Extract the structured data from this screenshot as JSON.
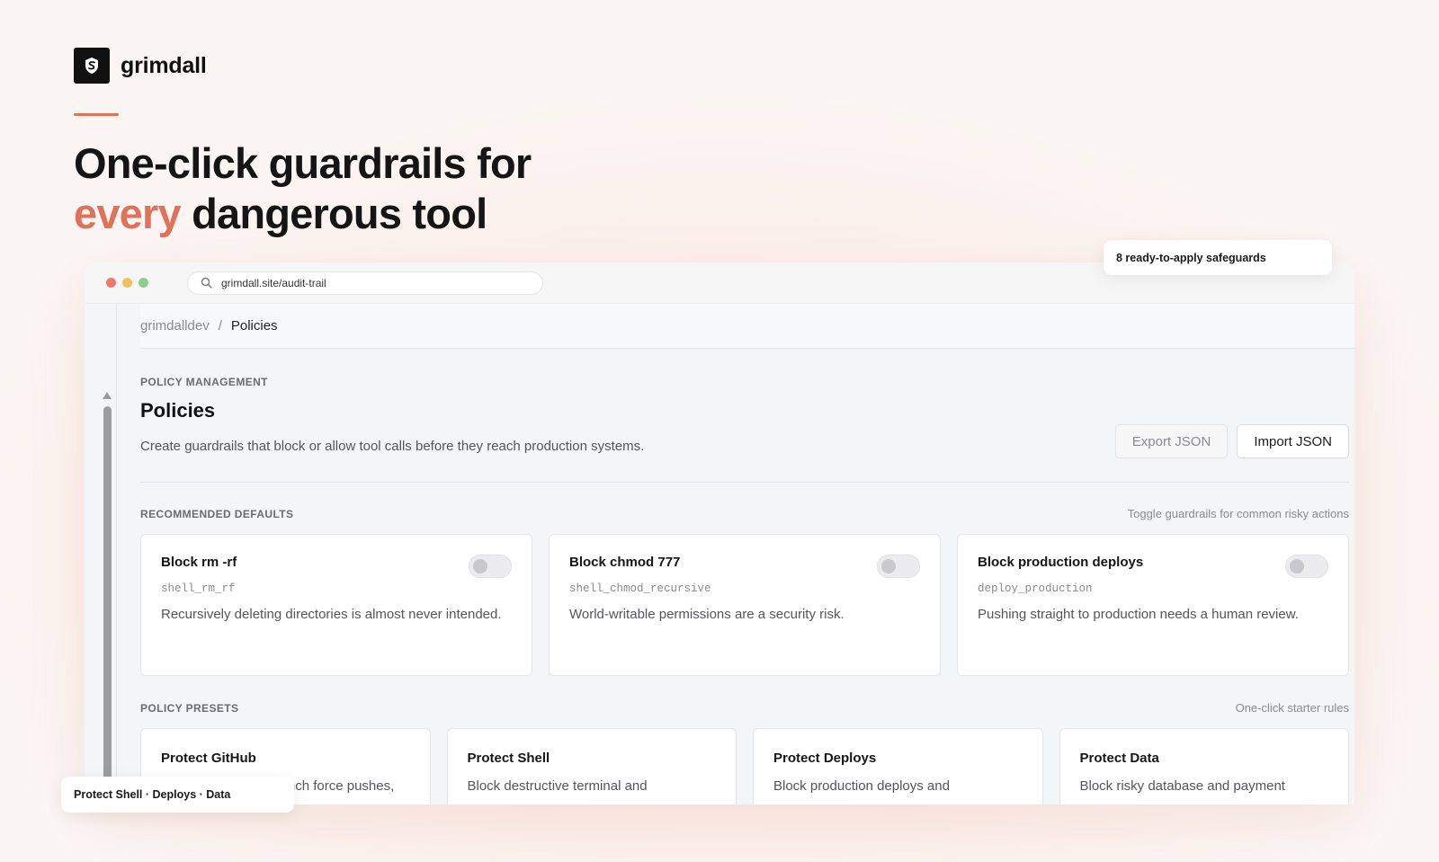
{
  "brand": {
    "name": "grimdall"
  },
  "hero": {
    "line1": "One-click guardrails for",
    "highlight": "every",
    "line2_rest": " dangerous tool",
    "accent_color": "#e0725a"
  },
  "browser": {
    "url": "grimdall.site/audit-trail"
  },
  "breadcrumb": {
    "org": "grimdalldev",
    "separator": "/",
    "current": "Policies"
  },
  "page": {
    "eyebrow": "POLICY MANAGEMENT",
    "title": "Policies",
    "description": "Create guardrails that block or allow tool calls before they reach production systems.",
    "export_label": "Export JSON",
    "import_label": "Import JSON"
  },
  "defaults": {
    "heading": "RECOMMENDED DEFAULTS",
    "note": "Toggle guardrails for common risky actions",
    "items": [
      {
        "title": "Block rm -rf",
        "code": "shell_rm_rf",
        "description": "Recursively deleting directories is almost never intended.",
        "enabled": false
      },
      {
        "title": "Block chmod 777",
        "code": "shell_chmod_recursive",
        "description": "World-writable permissions are a security risk.",
        "enabled": false
      },
      {
        "title": "Block production deploys",
        "code": "deploy_production",
        "description": "Pushing straight to production needs a human review.",
        "enabled": false
      }
    ]
  },
  "presets": {
    "heading": "POLICY PRESETS",
    "note": "One-click starter rules",
    "items": [
      {
        "title": "Protect GitHub",
        "description": "Block direct main-branch force pushes, and"
      },
      {
        "title": "Protect Shell",
        "description": "Block destructive terminal and"
      },
      {
        "title": "Protect Deploys",
        "description": "Block production deploys and"
      },
      {
        "title": "Protect Data",
        "description": "Block risky database and payment"
      }
    ]
  },
  "floats": {
    "top": "8 ready-to-apply safeguards",
    "bottom": "Protect Shell · Deploys · Data"
  },
  "icons": {
    "logo": "shield-s-logo-icon",
    "search": "search-icon",
    "toggle": "toggle-switch"
  }
}
